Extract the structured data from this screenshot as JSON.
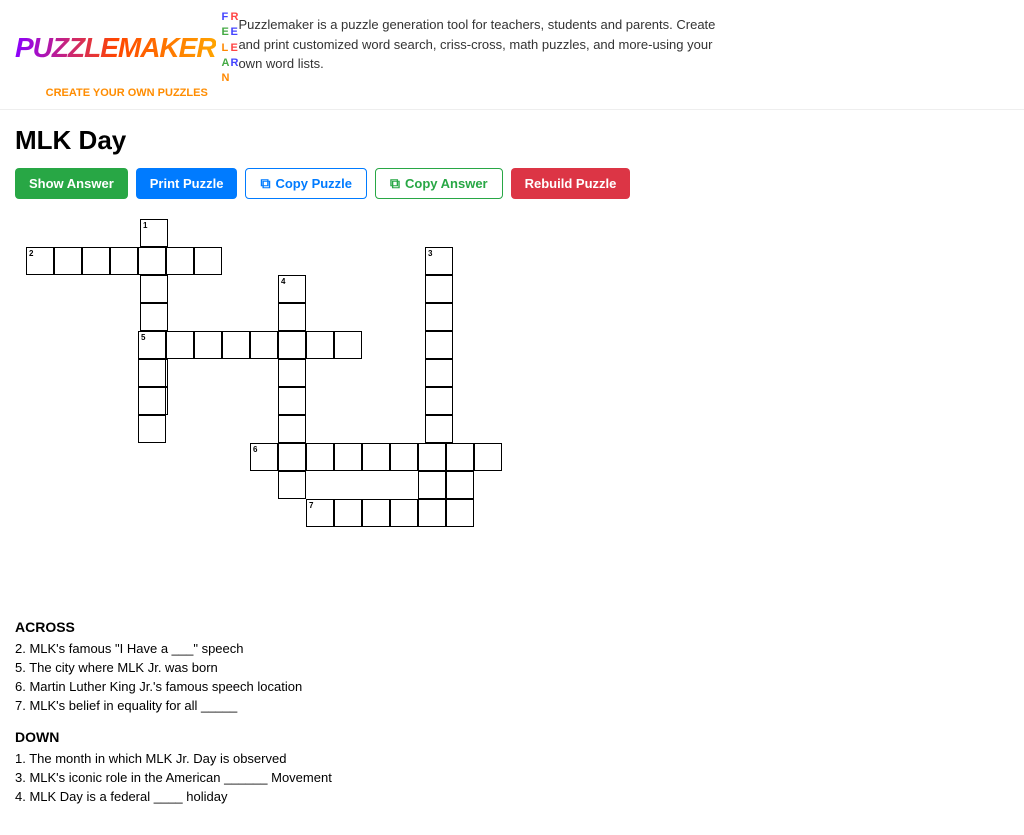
{
  "header": {
    "logo_main": "PUZZLEMAKER",
    "logo_sub": "CREATE YOUR OWN PUZZLES",
    "logo_letters": [
      "F",
      "R",
      "E",
      "E",
      "L",
      "E",
      "A",
      "R",
      "N"
    ],
    "description": "Puzzlemaker is a puzzle generation tool for teachers, students and parents. Create and print customized word search, criss-cross, math puzzles, and more-using your own word lists."
  },
  "page": {
    "title": "MLK Day"
  },
  "toolbar": {
    "show_answer": "Show Answer",
    "print_puzzle": "Print Puzzle",
    "copy_puzzle": "Copy Puzzle",
    "copy_answer": "Copy Answer",
    "rebuild_puzzle": "Rebuild Puzzle"
  },
  "clues": {
    "across_heading": "ACROSS",
    "across": [
      "2. MLK's famous \"I Have a ___\" speech",
      "5. The city where MLK Jr. was born",
      "6. Martin Luther King Jr.'s famous speech location",
      "7. MLK's belief in equality for all _____"
    ],
    "down_heading": "DOWN",
    "down": [
      "1. The month in which MLK Jr. Day is observed",
      "3. MLK's iconic role in the American ______ Movement",
      "4. MLK Day is a federal ____ holiday"
    ]
  }
}
